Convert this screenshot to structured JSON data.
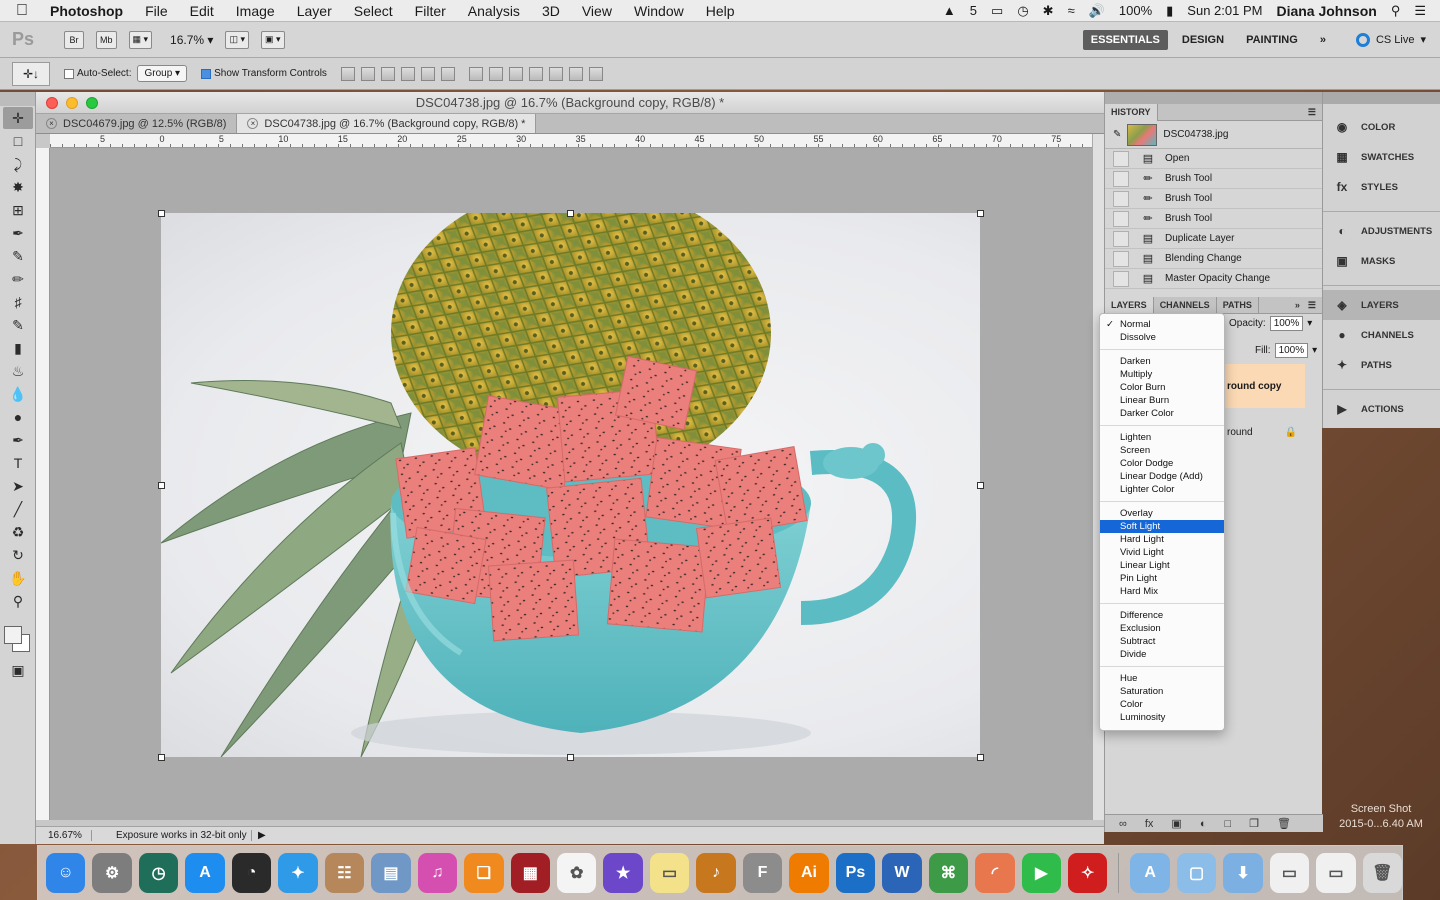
{
  "menubar": {
    "app_name": "Photoshop",
    "items": [
      "File",
      "Edit",
      "Image",
      "Layer",
      "Select",
      "Filter",
      "Analysis",
      "3D",
      "View",
      "Window",
      "Help"
    ],
    "adobe_count": "5",
    "battery": "100%",
    "clock": "Sun 2:01 PM",
    "user": "Diana Johnson"
  },
  "appbar": {
    "logo": "Ps",
    "bridge": "Br",
    "minibridge": "Mb",
    "zoom": "16.7%",
    "workspaces": [
      "ESSENTIALS",
      "DESIGN",
      "PAINTING"
    ],
    "more": "»",
    "cslive": "CS Live"
  },
  "options": {
    "auto_select_label": "Auto-Select:",
    "auto_select_value": "Group",
    "show_transform_label": "Show Transform Controls"
  },
  "document": {
    "title": "DSC04738.jpg @ 16.7% (Background copy, RGB/8) *",
    "tabs": [
      {
        "label": "DSC04679.jpg @ 12.5% (RGB/8)",
        "active": false
      },
      {
        "label": "DSC04738.jpg @ 16.7% (Background copy, RGB/8) *",
        "active": true
      }
    ],
    "ruler_labels": [
      "5",
      "0",
      "5",
      "10",
      "15",
      "20",
      "25",
      "30",
      "35",
      "40",
      "45",
      "50",
      "55",
      "60",
      "65",
      "70",
      "75"
    ],
    "status_zoom": "16.67%",
    "status_info": "Exposure works in 32-bit only"
  },
  "history": {
    "title": "HISTORY",
    "snapshot": "DSC04738.jpg",
    "steps": [
      "Open",
      "Brush Tool",
      "Brush Tool",
      "Brush Tool",
      "Duplicate Layer",
      "Blending Change",
      "Master Opacity Change"
    ]
  },
  "layers": {
    "tabs": [
      "LAYERS",
      "CHANNELS",
      "PATHS"
    ],
    "opacity_label": "Opacity:",
    "opacity": "100%",
    "fill_label": "Fill:",
    "fill": "100%",
    "layer_items": [
      "round copy",
      "round"
    ]
  },
  "blend_modes": {
    "groups": [
      [
        "Normal",
        "Dissolve"
      ],
      [
        "Darken",
        "Multiply",
        "Color Burn",
        "Linear Burn",
        "Darker Color"
      ],
      [
        "Lighten",
        "Screen",
        "Color Dodge",
        "Linear Dodge (Add)",
        "Lighter Color"
      ],
      [
        "Overlay",
        "Soft Light",
        "Hard Light",
        "Vivid Light",
        "Linear Light",
        "Pin Light",
        "Hard Mix"
      ],
      [
        "Difference",
        "Exclusion",
        "Subtract",
        "Divide"
      ],
      [
        "Hue",
        "Saturation",
        "Color",
        "Luminosity"
      ]
    ],
    "checked": "Normal",
    "highlighted": "Soft Light"
  },
  "dock_panels": {
    "items": [
      "COLOR",
      "SWATCHES",
      "STYLES",
      "ADJUSTMENTS",
      "MASKS",
      "LAYERS",
      "CHANNELS",
      "PATHS",
      "ACTIONS"
    ],
    "active": "LAYERS"
  },
  "desktop": {
    "label_line1": "Screen Shot",
    "label_line2": "2015-0...6.40 AM"
  },
  "dock": {
    "apps": [
      {
        "name": "Finder",
        "icon": "finder-icon",
        "color": "#2f86e8",
        "glyph": "☺"
      },
      {
        "name": "System Preferences",
        "icon": "gear-icon",
        "color": "#7d7d7d",
        "glyph": "⚙"
      },
      {
        "name": "Time Machine",
        "icon": "clock-icon",
        "color": "#1f6e5a",
        "glyph": "◷"
      },
      {
        "name": "App Store",
        "icon": "appstore-icon",
        "color": "#1d8ef0",
        "glyph": "A"
      },
      {
        "name": "Dashboard",
        "icon": "dashboard-icon",
        "color": "#2a2a2a",
        "glyph": "◔"
      },
      {
        "name": "Safari",
        "icon": "compass-icon",
        "color": "#2f9ae8",
        "glyph": "✦"
      },
      {
        "name": "Contacts",
        "icon": "contacts-icon",
        "color": "#b5875a",
        "glyph": "☷"
      },
      {
        "name": "Preview",
        "icon": "preview-icon",
        "color": "#6f98c6",
        "glyph": "▤"
      },
      {
        "name": "iTunes",
        "icon": "music-icon",
        "color": "#d54fb0",
        "glyph": "♫"
      },
      {
        "name": "iBooks",
        "icon": "book-icon",
        "color": "#f08a1e",
        "glyph": "❏"
      },
      {
        "name": "Photo Booth",
        "icon": "photobooth-icon",
        "color": "#a11f24",
        "glyph": "▦"
      },
      {
        "name": "Photos",
        "icon": "photos-icon",
        "color": "#f4f4f4",
        "glyph": "✿"
      },
      {
        "name": "iMovie",
        "icon": "star-icon",
        "color": "#6c47c9",
        "glyph": "★"
      },
      {
        "name": "Stickies",
        "icon": "stickies-icon",
        "color": "#f3e28a",
        "glyph": "▭"
      },
      {
        "name": "GarageBand",
        "icon": "guitar-icon",
        "color": "#c7781e",
        "glyph": "♪"
      },
      {
        "name": "Font Book",
        "icon": "fontbook-icon",
        "color": "#8c8c8c",
        "glyph": "F"
      },
      {
        "name": "Illustrator",
        "icon": "illustrator-icon",
        "color": "#ef7b00",
        "glyph": "Ai"
      },
      {
        "name": "Photoshop",
        "icon": "photoshop-icon",
        "color": "#1b6fc7",
        "glyph": "Ps"
      },
      {
        "name": "Word",
        "icon": "word-icon",
        "color": "#2b65b8",
        "glyph": "W"
      },
      {
        "name": "Sketch",
        "icon": "network-icon",
        "color": "#3d9a46",
        "glyph": "⌘"
      },
      {
        "name": "Keynote",
        "icon": "keynote-icon",
        "color": "#e8774e",
        "glyph": "◜"
      },
      {
        "name": "FaceTime",
        "icon": "facetime-icon",
        "color": "#2fbc4b",
        "glyph": "▶"
      },
      {
        "name": "Acrobat",
        "icon": "acrobat-icon",
        "color": "#d01d1d",
        "glyph": "✧"
      },
      {
        "name": "Applications",
        "icon": "folder-icon",
        "color": "#7fb5e6",
        "glyph": "A"
      },
      {
        "name": "Documents",
        "icon": "folder-icon",
        "color": "#8bbde8",
        "glyph": "▢"
      },
      {
        "name": "Downloads",
        "icon": "download-icon",
        "color": "#7db0e2",
        "glyph": "⬇"
      },
      {
        "name": "Screenshot",
        "icon": "screenshot-icon",
        "color": "#f0f0f0",
        "glyph": "▭"
      },
      {
        "name": "Screenshot 2",
        "icon": "screenshot-icon",
        "color": "#f0f0f0",
        "glyph": "▭"
      },
      {
        "name": "Trash",
        "icon": "trash-icon",
        "color": "#d9d9d9",
        "glyph": "🗑"
      }
    ]
  }
}
